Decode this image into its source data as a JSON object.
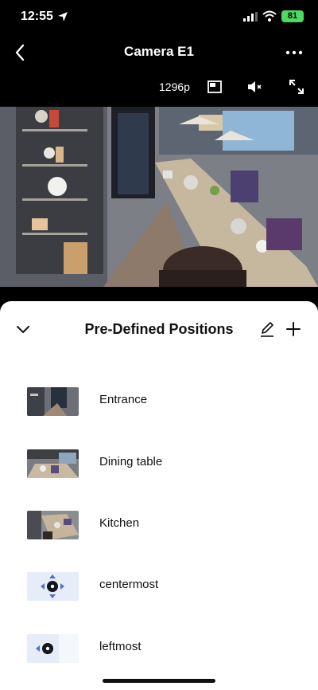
{
  "status": {
    "time": "12:55",
    "battery": "81"
  },
  "nav": {
    "title": "Camera E1"
  },
  "toolbar": {
    "resolution": "1296p"
  },
  "sheet": {
    "title": "Pre-Defined Positions",
    "positions": [
      {
        "label": "Entrance",
        "thumb": "entrance"
      },
      {
        "label": "Dining table",
        "thumb": "dining"
      },
      {
        "label": "Kitchen",
        "thumb": "kitchen"
      },
      {
        "label": "centermost",
        "thumb": "center-arrows"
      },
      {
        "label": "leftmost",
        "thumb": "left-arrows"
      }
    ]
  },
  "colors": {
    "accent": "#4a6fd6",
    "battery": "#4cd964"
  }
}
